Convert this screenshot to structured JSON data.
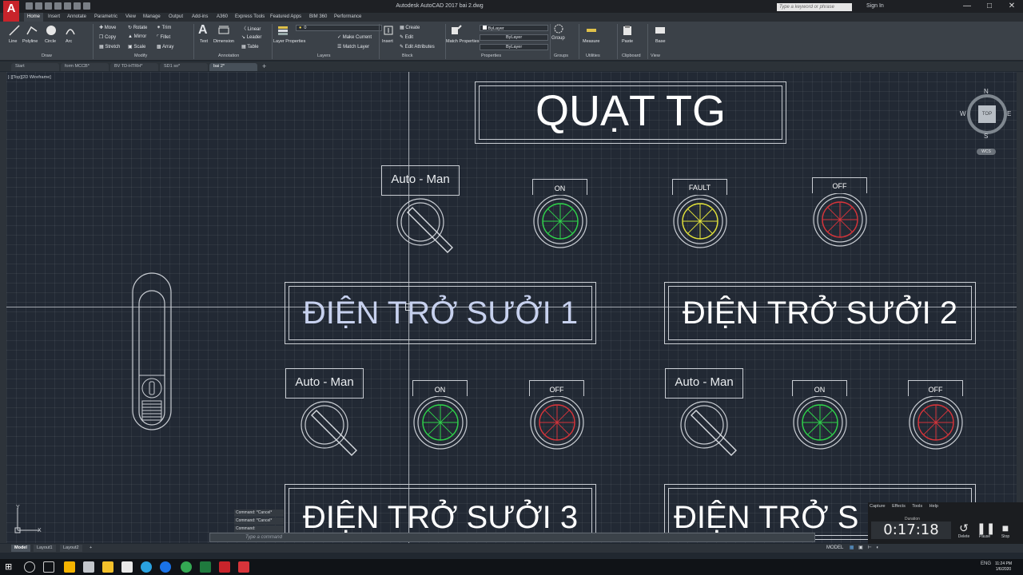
{
  "app": {
    "title": "Autodesk AutoCAD 2017    bai 2.dwg",
    "logo": "A",
    "search_placeholder": "Type a keyword or phrase",
    "sign_in": "Sign In"
  },
  "ribbon_tabs": [
    "Home",
    "Insert",
    "Annotate",
    "Parametric",
    "View",
    "Manage",
    "Output",
    "Add-ins",
    "A360",
    "Express Tools",
    "Featured Apps",
    "BIM 360",
    "Performance"
  ],
  "ribbon": {
    "draw": {
      "line": "Line",
      "polyline": "Polyline",
      "circle": "Circle",
      "arc": "Arc",
      "label": "Draw"
    },
    "modify": {
      "move": "Move",
      "rotate": "Rotate",
      "trim": "Trim",
      "copy": "Copy",
      "mirror": "Mirror",
      "fillet": "Fillet",
      "stretch": "Stretch",
      "scale": "Scale",
      "array": "Array",
      "label": "Modify"
    },
    "annotation": {
      "text": "Text",
      "dimension": "Dimension",
      "linear": "Linear",
      "leader": "Leader",
      "table": "Table",
      "label": "Annotation"
    },
    "layers": {
      "layer_properties": "Layer Properties",
      "current_layer": "0",
      "make_current": "Make Current",
      "match_layer": "Match Layer",
      "label": "Layers"
    },
    "block": {
      "insert": "Insert",
      "create": "Create",
      "edit": "Edit",
      "edit_attributes": "Edit Attributes",
      "label": "Block"
    },
    "properties": {
      "match": "Match Properties",
      "color": "ByLayer",
      "linetype": "ByLayer",
      "lineweight": "ByLayer",
      "label": "Properties"
    },
    "groups": {
      "group": "Group",
      "label": "Groups"
    },
    "utilities": {
      "measure": "Measure",
      "label": "Utilities"
    },
    "clipboard": {
      "paste": "Paste",
      "label": "Clipboard"
    },
    "view": {
      "base": "Base",
      "label": "View"
    }
  },
  "doc_tabs": [
    "Start",
    "form MCCB*",
    "BV TD-HTRH*",
    "SD1 so*",
    "bai 2*"
  ],
  "viewport_label": "[-][Top][2D Wireframe]",
  "viewcube": {
    "top": "TOP",
    "n": "N",
    "s": "S",
    "e": "E",
    "w": "W",
    "wcs": "WCS"
  },
  "drawing": {
    "title": "QUẠT TG",
    "selector_label": "Auto  -  Man",
    "heater1": "ĐIỆN TRỞ SƯỞI 1",
    "heater2": "ĐIỆN TRỞ SƯỞI 2",
    "heater3": "ĐIỆN TRỞ SƯỞI 3",
    "heater4": "ĐIỆN TRỞ S",
    "lamp_on": "ON",
    "lamp_fault": "FAULT",
    "lamp_off": "OFF",
    "colors": {
      "green": "#2fd24a",
      "yellow": "#e2e23a",
      "red": "#d7343a"
    }
  },
  "command": {
    "history": [
      "Command: *Cancel*",
      "Command: *Cancel*",
      "Command:"
    ],
    "placeholder": "Type a command"
  },
  "layout_tabs": [
    "Model",
    "Layout1",
    "Layout2"
  ],
  "status": {
    "mode": "MODEL"
  },
  "recorder": {
    "menu": [
      "Capture",
      "Effects",
      "Tools",
      "Help"
    ],
    "duration_label": "Duration",
    "duration": "0:17:18",
    "delete": "Delete",
    "pause": "Pause",
    "stop": "Stop"
  },
  "taskbar": {
    "lang": "ENG",
    "time": "11:24 PM",
    "date": "1/6/2020"
  }
}
